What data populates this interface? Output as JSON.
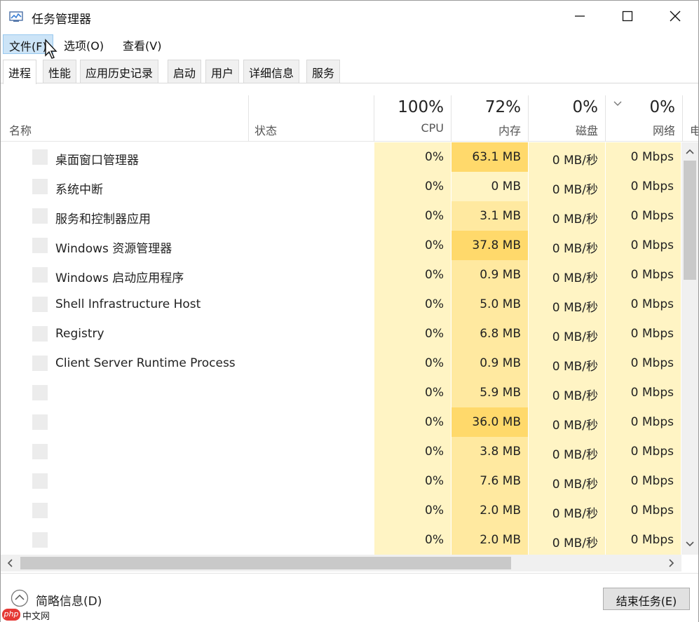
{
  "window": {
    "title": "任务管理器",
    "app_icon": "task-manager-icon"
  },
  "menu": [
    {
      "label": "文件(F)"
    },
    {
      "label": "选项(O)"
    },
    {
      "label": "查看(V)"
    }
  ],
  "tabs": [
    {
      "label": "进程",
      "selected": true
    },
    {
      "label": "性能"
    },
    {
      "label": "应用历史记录"
    },
    {
      "label": "启动"
    },
    {
      "label": "用户"
    },
    {
      "label": "详细信息"
    },
    {
      "label": "服务"
    }
  ],
  "columns": {
    "name": "名称",
    "status": "状态",
    "cpu": {
      "percent": "100%",
      "label": "CPU"
    },
    "memory": {
      "percent": "72%",
      "label": "内存"
    },
    "disk": {
      "percent": "0%",
      "label": "磁盘"
    },
    "network": {
      "percent": "0%",
      "label": "网络"
    },
    "power_partial": "电"
  },
  "rows": [
    {
      "name": "桌面窗口管理器",
      "cpu": "0%",
      "mem": "63.1 MB",
      "disk": "0 MB/秒",
      "net": "0 Mbps"
    },
    {
      "name": "系统中断",
      "cpu": "0%",
      "mem": "0 MB",
      "disk": "0 MB/秒",
      "net": "0 Mbps"
    },
    {
      "name": "服务和控制器应用",
      "cpu": "0%",
      "mem": "3.1 MB",
      "disk": "0 MB/秒",
      "net": "0 Mbps"
    },
    {
      "name": "Windows 资源管理器",
      "cpu": "0%",
      "mem": "37.8 MB",
      "disk": "0 MB/秒",
      "net": "0 Mbps"
    },
    {
      "name": "Windows 启动应用程序",
      "cpu": "0%",
      "mem": "0.9 MB",
      "disk": "0 MB/秒",
      "net": "0 Mbps"
    },
    {
      "name": "Shell Infrastructure Host",
      "cpu": "0%",
      "mem": "5.0 MB",
      "disk": "0 MB/秒",
      "net": "0 Mbps"
    },
    {
      "name": "Registry",
      "cpu": "0%",
      "mem": "6.8 MB",
      "disk": "0 MB/秒",
      "net": "0 Mbps"
    },
    {
      "name": "Client Server Runtime Process",
      "cpu": "0%",
      "mem": "0.9 MB",
      "disk": "0 MB/秒",
      "net": "0 Mbps"
    },
    {
      "name": "",
      "cpu": "0%",
      "mem": "5.9 MB",
      "disk": "0 MB/秒",
      "net": "0 Mbps"
    },
    {
      "name": "",
      "cpu": "0%",
      "mem": "36.0 MB",
      "disk": "0 MB/秒",
      "net": "0 Mbps"
    },
    {
      "name": "",
      "cpu": "0%",
      "mem": "3.8 MB",
      "disk": "0 MB/秒",
      "net": "0 Mbps"
    },
    {
      "name": "",
      "cpu": "0%",
      "mem": "7.6 MB",
      "disk": "0 MB/秒",
      "net": "0 Mbps"
    },
    {
      "name": "",
      "cpu": "0%",
      "mem": "2.0 MB",
      "disk": "0 MB/秒",
      "net": "0 Mbps"
    },
    {
      "name": "",
      "cpu": "0%",
      "mem": "2.0 MB",
      "disk": "0 MB/秒",
      "net": "0 Mbps"
    }
  ],
  "colors": {
    "heat_light": "#fff4c4",
    "heat_medium": "#ffe9a0",
    "heat_strong": "#ffd96b",
    "menu_highlight": "#cce4f7"
  },
  "footer": {
    "fewer_details": "简略信息(D)",
    "end_task": "结束任务(E)"
  },
  "watermark": {
    "logo": "php",
    "text": "中文网"
  }
}
